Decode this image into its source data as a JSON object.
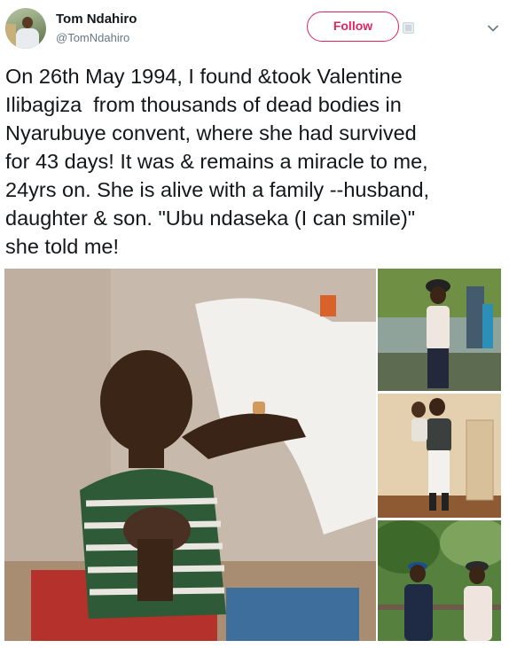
{
  "user": {
    "display_name": "Tom Ndahiro",
    "handle": "@TomNdahiro",
    "avatar_icon": "user-avatar",
    "follow_label": "Follow"
  },
  "icons": {
    "block": "block-icon",
    "menu": "chevron-down-icon"
  },
  "colors": {
    "follow_accent": "#e0245e",
    "text": "#14171a",
    "secondary_text": "#657786"
  },
  "tweet": {
    "text": "On 26th May 1994, I found &took Valentine\nIlibagiza  from thousands of dead bodies in\nNyarubuye convent, where she had survived\nfor 43 days! It was & remains a miracle to me,\n24yrs on. She is alive with a family --husband,\ndaughter & son. \"Ubu ndaseka (I can smile)\"\nshe told me!"
  },
  "media": {
    "photo_count": 4
  }
}
